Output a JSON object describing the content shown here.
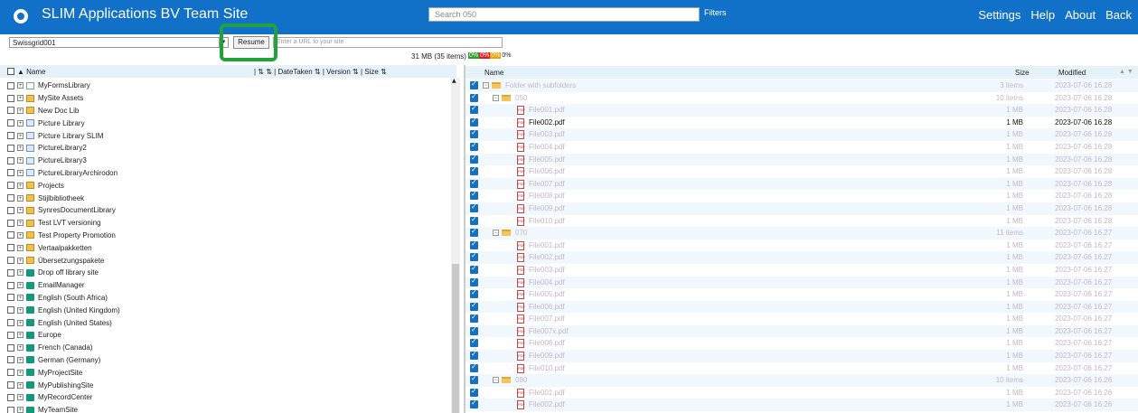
{
  "topbar": {
    "title": "SLIM Applications BV Team Site",
    "search_placeholder": "Search 050",
    "filters": "Filters",
    "nav": [
      "Settings",
      "Help",
      "About",
      "Back"
    ]
  },
  "toolbar": {
    "site": "Swissgrid001",
    "resume": "Resume",
    "url_placeholder": "Enter a URL to your site",
    "status_size": "31 MB (35 items)",
    "percents": [
      "0%",
      "0%",
      "0%",
      "0%"
    ]
  },
  "left": {
    "header": {
      "name": "▲ Name",
      "cols": "|  ⇅  ⇅      | DateTaken ⇅  | Version ⇅   | Size ⇅"
    },
    "rows": [
      {
        "label": "MyFormsLibrary",
        "icon": "library"
      },
      {
        "label": "MySite Assets",
        "icon": "doclib"
      },
      {
        "label": "New Doc Lib",
        "icon": "doclib"
      },
      {
        "label": "Picture Library",
        "icon": "picture"
      },
      {
        "label": "Picture Library SLIM",
        "icon": "picture"
      },
      {
        "label": "PictureLibrary2",
        "icon": "picture"
      },
      {
        "label": "PictureLibrary3",
        "icon": "picture"
      },
      {
        "label": "PictureLibraryArchirodon",
        "icon": "picture"
      },
      {
        "label": "Projects",
        "icon": "doclib"
      },
      {
        "label": "Stijlbibliotheek",
        "icon": "doclib"
      },
      {
        "label": "SynresDocumentLibrary",
        "icon": "doclib"
      },
      {
        "label": "Test LVT versioning",
        "icon": "doclib"
      },
      {
        "label": "Test Property Promotion",
        "icon": "doclib"
      },
      {
        "label": "Vertaalpakketten",
        "icon": "doclib"
      },
      {
        "label": "Übersetzungspakete",
        "icon": "doclib"
      },
      {
        "label": "Drop off library site",
        "icon": "site"
      },
      {
        "label": "EmailManager",
        "icon": "site"
      },
      {
        "label": "English (South Africa)",
        "icon": "site"
      },
      {
        "label": "English (United Kingdom)",
        "icon": "site"
      },
      {
        "label": "English (United States)",
        "icon": "site"
      },
      {
        "label": "Europe",
        "icon": "site"
      },
      {
        "label": "French (Canada)",
        "icon": "site"
      },
      {
        "label": "German (Germany)",
        "icon": "site"
      },
      {
        "label": "MyProjectSite",
        "icon": "site"
      },
      {
        "label": "MyPublishingSite",
        "icon": "site"
      },
      {
        "label": "MyRecordCenter",
        "icon": "site"
      },
      {
        "label": "MyTeamSite",
        "icon": "site"
      }
    ]
  },
  "right": {
    "header": {
      "name": "Name",
      "size": "Size",
      "modified": "Modified",
      "arrows": "▲ ▼"
    },
    "rows": [
      {
        "kind": "folder",
        "level": 0,
        "name": "Folder with subfolders",
        "size": "3 items",
        "modified": "2023-07-06 16.28",
        "dark": false
      },
      {
        "kind": "folder",
        "level": 1,
        "name": "050",
        "size": "10 items",
        "modified": "2023-07-06 16.28",
        "dark": false
      },
      {
        "kind": "file",
        "level": 2,
        "name": "File001.pdf",
        "size": "1 MB",
        "modified": "2023-07-06 16.28",
        "dark": false
      },
      {
        "kind": "file",
        "level": 2,
        "name": "File002.pdf",
        "size": "1 MB",
        "modified": "2023-07-06 16.28",
        "dark": true
      },
      {
        "kind": "file",
        "level": 2,
        "name": "File003.pdf",
        "size": "1 MB",
        "modified": "2023-07-06 16.28",
        "dark": false
      },
      {
        "kind": "file",
        "level": 2,
        "name": "File004.pdf",
        "size": "1 MB",
        "modified": "2023-07-06 16.28",
        "dark": false
      },
      {
        "kind": "file",
        "level": 2,
        "name": "File005.pdf",
        "size": "1 MB",
        "modified": "2023-07-06 16.28",
        "dark": false
      },
      {
        "kind": "file",
        "level": 2,
        "name": "File006.pdf",
        "size": "1 MB",
        "modified": "2023-07-06 16.28",
        "dark": false
      },
      {
        "kind": "file",
        "level": 2,
        "name": "File007.pdf",
        "size": "1 MB",
        "modified": "2023-07-06 16.28",
        "dark": false
      },
      {
        "kind": "file",
        "level": 2,
        "name": "File008.pdf",
        "size": "1 MB",
        "modified": "2023-07-06 16.28",
        "dark": false
      },
      {
        "kind": "file",
        "level": 2,
        "name": "File009.pdf",
        "size": "1 MB",
        "modified": "2023-07-06 16.28",
        "dark": false
      },
      {
        "kind": "file",
        "level": 2,
        "name": "File010.pdf",
        "size": "1 MB",
        "modified": "2023-07-06 16.28",
        "dark": false
      },
      {
        "kind": "folder",
        "level": 1,
        "name": "070",
        "size": "11 items",
        "modified": "2023-07-06 16.27",
        "dark": false
      },
      {
        "kind": "file",
        "level": 2,
        "name": "File001.pdf",
        "size": "1 MB",
        "modified": "2023-07-06 16.27",
        "dark": false
      },
      {
        "kind": "file",
        "level": 2,
        "name": "File002.pdf",
        "size": "1 MB",
        "modified": "2023-07-06 16.27",
        "dark": false
      },
      {
        "kind": "file",
        "level": 2,
        "name": "File003.pdf",
        "size": "1 MB",
        "modified": "2023-07-06 16.27",
        "dark": false
      },
      {
        "kind": "file",
        "level": 2,
        "name": "File004.pdf",
        "size": "1 MB",
        "modified": "2023-07-06 16.27",
        "dark": false
      },
      {
        "kind": "file",
        "level": 2,
        "name": "File005.pdf",
        "size": "1 MB",
        "modified": "2023-07-06 16.27",
        "dark": false
      },
      {
        "kind": "file",
        "level": 2,
        "name": "File006.pdf",
        "size": "1 MB",
        "modified": "2023-07-06 16.27",
        "dark": false
      },
      {
        "kind": "file",
        "level": 2,
        "name": "File007.pdf",
        "size": "1 MB",
        "modified": "2023-07-06 16.27",
        "dark": false
      },
      {
        "kind": "file",
        "level": 2,
        "name": "File007x.pdf",
        "size": "1 MB",
        "modified": "2023-07-06 16.27",
        "dark": false
      },
      {
        "kind": "file",
        "level": 2,
        "name": "File008.pdf",
        "size": "1 MB",
        "modified": "2023-07-06 16.27",
        "dark": false
      },
      {
        "kind": "file",
        "level": 2,
        "name": "File009.pdf",
        "size": "1 MB",
        "modified": "2023-07-06 16.27",
        "dark": false
      },
      {
        "kind": "file",
        "level": 2,
        "name": "File010.pdf",
        "size": "1 MB",
        "modified": "2023-07-06 16.27",
        "dark": false
      },
      {
        "kind": "folder",
        "level": 1,
        "name": "080",
        "size": "10 items",
        "modified": "2023-07-06 16.26",
        "dark": false
      },
      {
        "kind": "file",
        "level": 2,
        "name": "File001.pdf",
        "size": "1 MB",
        "modified": "2023-07-06 16.26",
        "dark": false
      },
      {
        "kind": "file",
        "level": 2,
        "name": "File002.pdf",
        "size": "1 MB",
        "modified": "2023-07-06 16.26",
        "dark": false
      }
    ]
  },
  "colors": {
    "topbar": "#1170c8",
    "highlight": "#22a23a",
    "row_alt": "#f1f8fd",
    "dim_text": "#c5b7c8",
    "checkbox": "#1670c0"
  }
}
